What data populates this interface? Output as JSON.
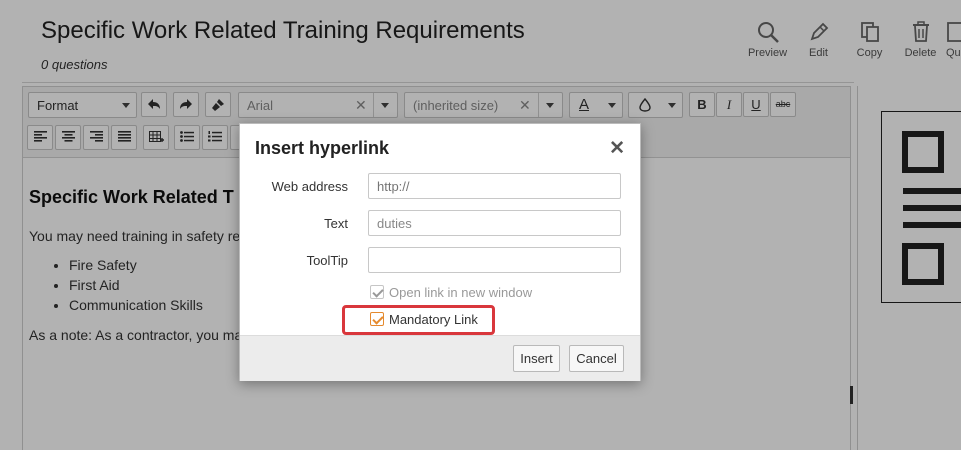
{
  "page": {
    "title": "Specific Work Related Training Requirements",
    "subtitle": "0 questions"
  },
  "actions": [
    {
      "label": "Preview",
      "icon": "search-icon"
    },
    {
      "label": "Edit",
      "icon": "pencil-icon"
    },
    {
      "label": "Copy",
      "icon": "copy-icon"
    },
    {
      "label": "Delete",
      "icon": "trash-icon"
    },
    {
      "label": "Qu",
      "icon": "question-icon"
    }
  ],
  "toolbar": {
    "format_label": "Format",
    "font_label": "Arial",
    "size_label": "(inherited size)",
    "clear_glyph": "✕",
    "font_color_glyph": "A",
    "bold": "B",
    "italic": "I",
    "underline": "U",
    "strike": "abc"
  },
  "document": {
    "heading": "Specific Work Related T",
    "intro": "You may need training in safety re",
    "list": [
      "Fire Safety",
      "First Aid",
      "Communication Skills"
    ],
    "note": "As a note: As a contractor, you ma"
  },
  "dialog": {
    "title": "Insert hyperlink",
    "close_glyph": "✕",
    "web_address_label": "Web address",
    "web_address_placeholder": "http://",
    "text_label": "Text",
    "text_value": "duties",
    "tooltip_label": "ToolTip",
    "tooltip_value": "",
    "new_window_label": "Open link in new window",
    "mandatory_label": "Mandatory Link",
    "insert_label": "Insert",
    "cancel_label": "Cancel"
  },
  "colors": {
    "highlight": "#d9373c",
    "checkbox_accent": "#e58a2e"
  }
}
